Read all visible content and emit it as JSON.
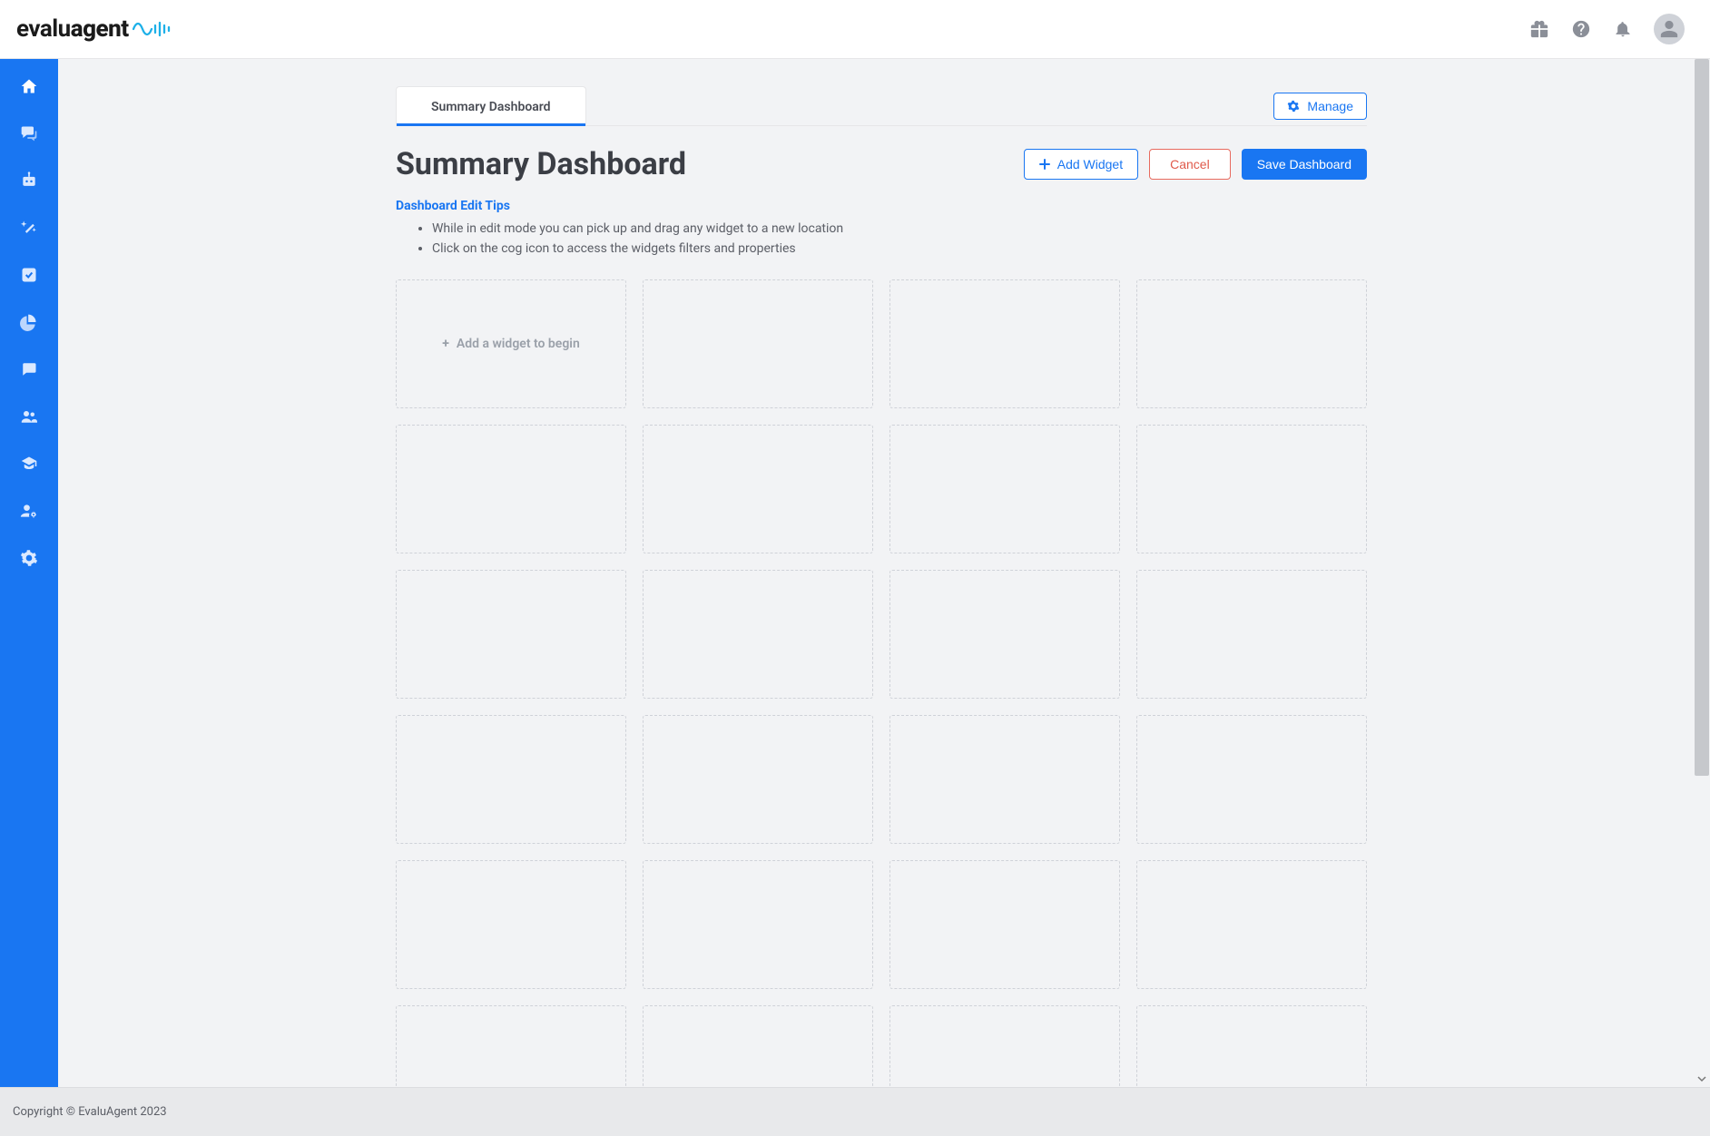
{
  "brand": {
    "name_part1": "evalu",
    "name_part2": "agent"
  },
  "topbar_icons": [
    "gift-icon",
    "help-icon",
    "bell-icon",
    "user-avatar"
  ],
  "sidebar": {
    "items": [
      {
        "icon": "home-icon"
      },
      {
        "icon": "chat-icon"
      },
      {
        "icon": "robot-icon"
      },
      {
        "icon": "wand-icon"
      },
      {
        "icon": "checkbox-icon"
      },
      {
        "icon": "pie-chart-icon"
      },
      {
        "icon": "message-icon"
      },
      {
        "icon": "users-icon"
      },
      {
        "icon": "graduation-cap-icon"
      },
      {
        "icon": "user-cog-icon"
      },
      {
        "icon": "gear-icon"
      }
    ]
  },
  "tabs": {
    "active_label": "Summary Dashboard"
  },
  "manage_button": {
    "label": "Manage"
  },
  "page_title": "Summary Dashboard",
  "buttons": {
    "add_widget": "Add Widget",
    "cancel": "Cancel",
    "save_dashboard": "Save Dashboard"
  },
  "tips": {
    "heading": "Dashboard Edit Tips",
    "items": [
      "While in edit mode you can pick up and drag any widget to a new location",
      "Click on the cog icon to access the widgets filters and properties"
    ]
  },
  "add_widget_slot_label": "Add a widget to begin",
  "footer": {
    "copyright": "Copyright © EvaluAgent 2023"
  }
}
